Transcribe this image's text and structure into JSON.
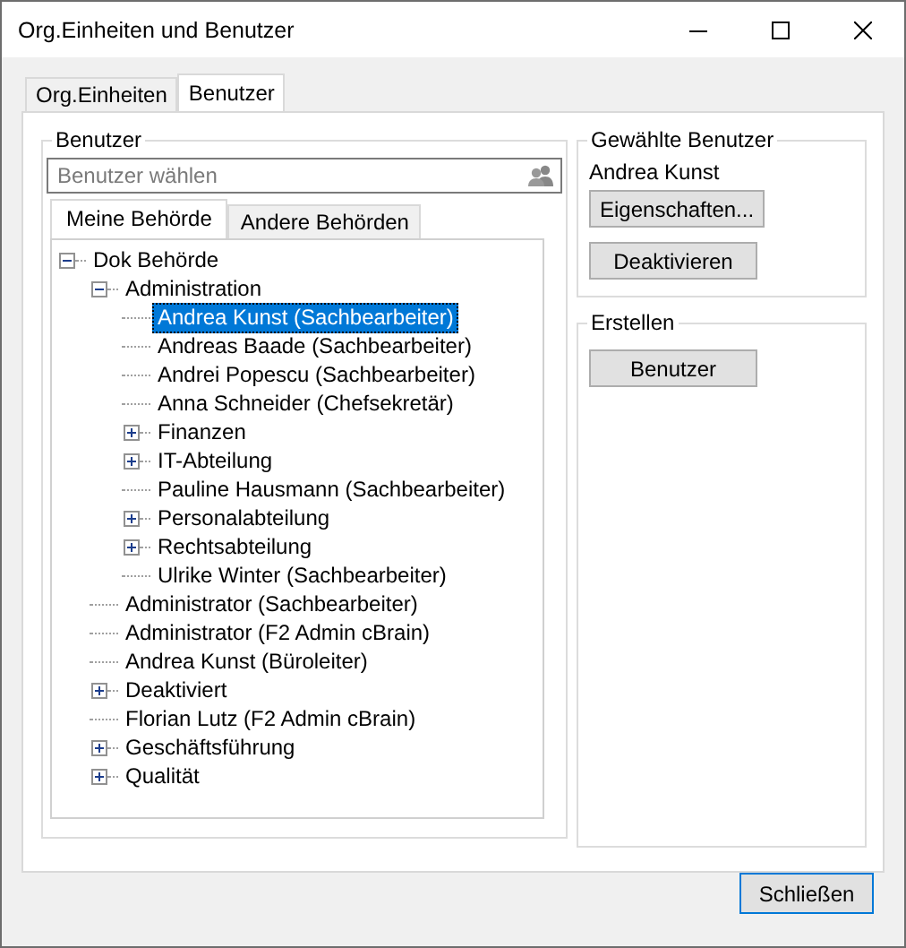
{
  "window": {
    "title": "Org.Einheiten und Benutzer"
  },
  "tabs": [
    {
      "label": "Org.Einheiten",
      "selected": false
    },
    {
      "label": "Benutzer",
      "selected": true
    }
  ],
  "users_group": {
    "title": "Benutzer",
    "search": {
      "placeholder": "Benutzer wählen"
    },
    "tabs": [
      {
        "label": "Meine Behörde",
        "selected": true
      },
      {
        "label": "Andere Behörden",
        "selected": false
      }
    ],
    "tree": [
      {
        "label": "Dok Behörde",
        "expanded": true,
        "selected": false,
        "children": [
          {
            "label": "Administration",
            "expanded": true,
            "selected": false,
            "children": [
              {
                "label": "Andrea Kunst (Sachbearbeiter)",
                "selected": true
              },
              {
                "label": "Andreas Baade (Sachbearbeiter)",
                "selected": false
              },
              {
                "label": "Andrei Popescu (Sachbearbeiter)",
                "selected": false
              },
              {
                "label": "Anna Schneider (Chefsekretär)",
                "selected": false
              },
              {
                "label": "Finanzen",
                "expanded": false,
                "selected": false
              },
              {
                "label": "IT-Abteilung",
                "expanded": false,
                "selected": false
              },
              {
                "label": "Pauline Hausmann (Sachbearbeiter)",
                "selected": false
              },
              {
                "label": "Personalabteilung",
                "expanded": false,
                "selected": false
              },
              {
                "label": "Rechtsabteilung",
                "expanded": false,
                "selected": false
              },
              {
                "label": "Ulrike Winter (Sachbearbeiter)",
                "selected": false
              }
            ]
          },
          {
            "label": "Administrator (Sachbearbeiter)",
            "selected": false
          },
          {
            "label": "Administrator (F2 Admin cBrain)",
            "selected": false
          },
          {
            "label": "Andrea Kunst (Büroleiter)",
            "selected": false
          },
          {
            "label": "Deaktiviert",
            "expanded": false,
            "selected": false
          },
          {
            "label": "Florian Lutz (F2 Admin cBrain)",
            "selected": false
          },
          {
            "label": "Geschäftsführung",
            "expanded": false,
            "selected": false
          },
          {
            "label": "Qualität",
            "expanded": false,
            "selected": false
          }
        ]
      }
    ]
  },
  "selected_group": {
    "title": "Gewählte Benutzer",
    "name": "Andrea Kunst",
    "buttons": [
      "Eigenschaften...",
      "Deaktivieren"
    ]
  },
  "create_group": {
    "title": "Erstellen",
    "buttons": [
      "Benutzer"
    ]
  },
  "close_button": "Schließen"
}
